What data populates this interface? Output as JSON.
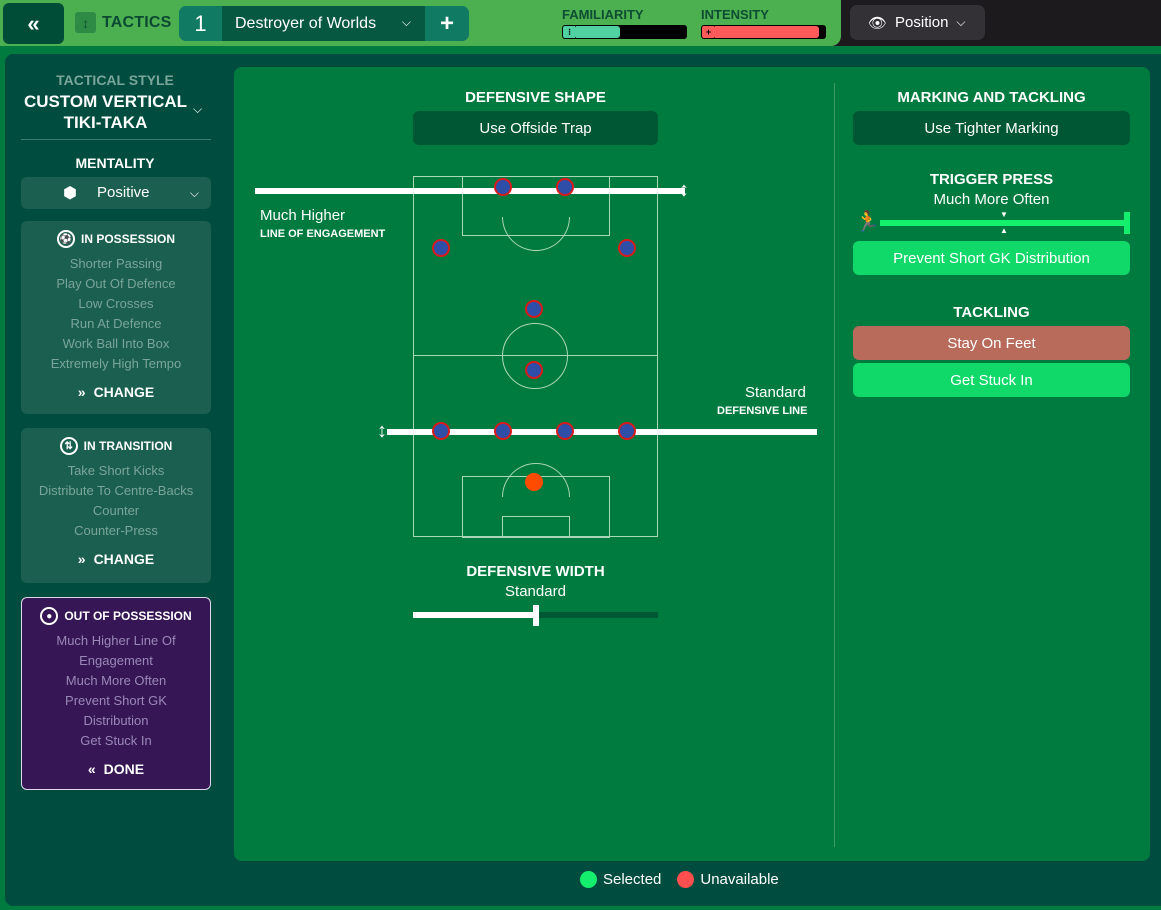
{
  "topbar": {
    "back_icon": "double-chevron-left-icon",
    "back_glyph": "«",
    "section_icon": "tactics-icon",
    "section_label": "TACTICS",
    "tactic_number": "1",
    "tactic_name": "Destroyer of Worlds",
    "add_glyph": "+",
    "familiarity_label": "FAMILIARITY",
    "familiarity_value": 0.4,
    "intensity_label": "INTENSITY",
    "intensity_value": 0.95,
    "view_selector": "Position"
  },
  "sidebar": {
    "tactical_style_label": "TACTICAL STYLE",
    "tactical_style_value": "CUSTOM VERTICAL TIKI-TAKA",
    "mentality_label": "MENTALITY",
    "mentality_value": "Positive",
    "in_possession": {
      "title": "IN POSSESSION",
      "items": [
        "Shorter Passing",
        "Play Out Of Defence",
        "Low Crosses",
        "Run At Defence",
        "Work Ball Into Box",
        "Extremely High Tempo"
      ],
      "action": "CHANGE"
    },
    "in_transition": {
      "title": "IN TRANSITION",
      "items": [
        "Take Short Kicks",
        "Distribute To Centre-Backs",
        "Counter",
        "Counter-Press"
      ],
      "action": "CHANGE"
    },
    "out_of_possession": {
      "title": "OUT OF POSSESSION",
      "items": [
        "Much Higher Line Of",
        "Engagement",
        "Much More Often",
        "Prevent Short GK",
        "Distribution",
        "Get Stuck In"
      ],
      "action": "DONE"
    }
  },
  "defensive_shape": {
    "title": "DEFENSIVE SHAPE",
    "offside_trap_button": "Use Offside Trap",
    "line_of_engagement_value": "Much Higher",
    "line_of_engagement_caption": "LINE OF ENGAGEMENT",
    "defensive_line_value": "Standard",
    "defensive_line_caption": "DEFENSIVE LINE",
    "width_title": "DEFENSIVE WIDTH",
    "width_value": "Standard",
    "width_level": 0.5
  },
  "marking": {
    "title": "MARKING AND TACKLING",
    "tighter_marking_button": "Use Tighter Marking",
    "trigger_press_title": "TRIGGER PRESS",
    "trigger_press_value": "Much More Often",
    "trigger_press_level": 1.0,
    "prevent_gk_button": "Prevent Short GK Distribution",
    "tackling_title": "TACKLING",
    "stay_on_feet_button": "Stay On Feet",
    "get_stuck_in_button": "Get Stuck In"
  },
  "legend": {
    "selected_label": "Selected",
    "selected_color": "#14f06e",
    "unavailable_label": "Unavailable",
    "unavailable_color": "#ff4f4f"
  },
  "colors": {
    "accent_green": "#10d96a",
    "unavailable_red": "#b86b5a",
    "player_fill": "#2e4ea8",
    "player_border": "#d81c1c",
    "goalkeeper": "#ff4b00"
  }
}
